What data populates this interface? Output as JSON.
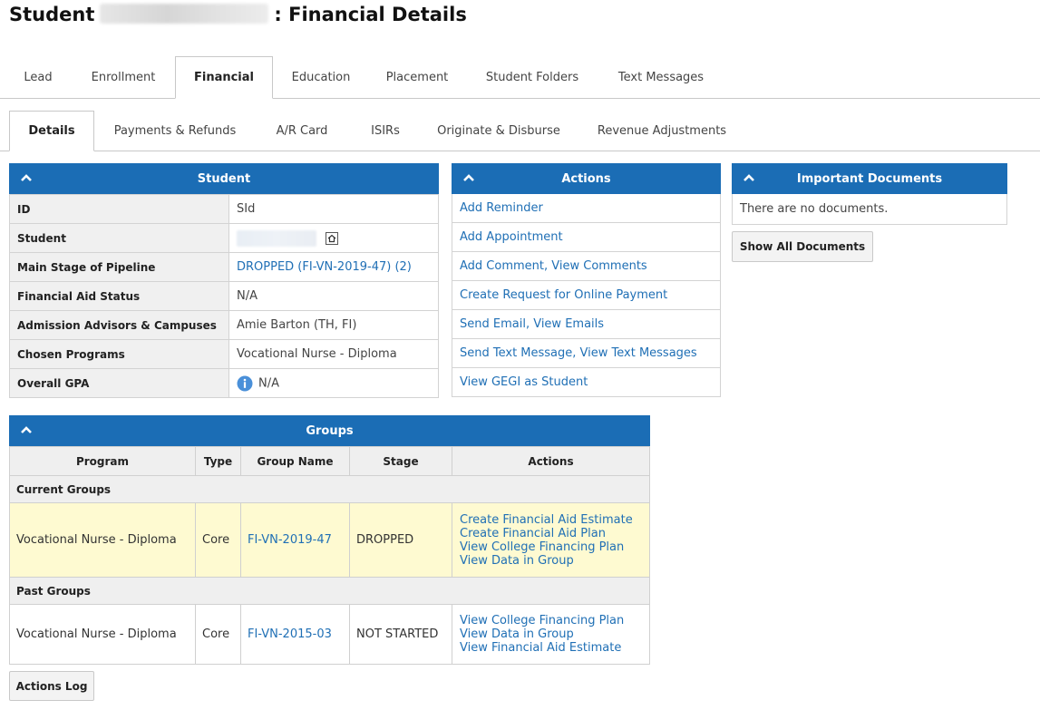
{
  "page": {
    "title_prefix": "Student",
    "title_suffix": ": Financial Details"
  },
  "main_tabs": [
    {
      "label": "Lead"
    },
    {
      "label": "Enrollment"
    },
    {
      "label": "Financial"
    },
    {
      "label": "Education"
    },
    {
      "label": "Placement"
    },
    {
      "label": "Student Folders"
    },
    {
      "label": "Text Messages"
    }
  ],
  "sub_tabs": [
    {
      "label": "Details"
    },
    {
      "label": "Payments & Refunds"
    },
    {
      "label": "A/R Card"
    },
    {
      "label": "ISIRs"
    },
    {
      "label": "Originate & Disburse"
    },
    {
      "label": "Revenue Adjustments"
    }
  ],
  "student_panel": {
    "title": "Student",
    "rows": [
      {
        "key": "ID",
        "value": "SId"
      },
      {
        "key": "Student",
        "value": ""
      },
      {
        "key": "Main Stage of Pipeline",
        "value": "DROPPED (FI-VN-2019-47) (2)"
      },
      {
        "key": "Financial Aid Status",
        "value": "N/A"
      },
      {
        "key": "Admission Advisors & Campuses",
        "value": "Amie Barton (TH, FI)"
      },
      {
        "key": "Chosen Programs",
        "value": "Vocational Nurse - Diploma"
      },
      {
        "key": "Overall GPA",
        "value": "N/A"
      }
    ]
  },
  "actions_panel": {
    "title": "Actions",
    "items": [
      "Add Reminder",
      "Add Appointment",
      "Add Comment, View Comments",
      "Create Request for Online Payment",
      "Send Email, View Emails",
      "Send Text Message, View Text Messages",
      "View GEGI as Student"
    ]
  },
  "documents_panel": {
    "title": "Important Documents",
    "empty_text": "There are no documents.",
    "show_all_label": "Show All Documents"
  },
  "groups_panel": {
    "title": "Groups",
    "columns": [
      "Program",
      "Type",
      "Group Name",
      "Stage",
      "Actions"
    ],
    "current_label": "Current Groups",
    "past_label": "Past Groups",
    "current": {
      "program": "Vocational Nurse - Diploma",
      "type": "Core",
      "group_name": "FI-VN-2019-47",
      "stage": "DROPPED",
      "actions": [
        "Create Financial Aid Estimate",
        "Create Financial Aid Plan",
        "View College Financing Plan",
        "View Data in Group"
      ]
    },
    "past": {
      "program": "Vocational Nurse - Diploma",
      "type": "Core",
      "group_name": "FI-VN-2015-03",
      "stage": "NOT STARTED",
      "actions": [
        "View College Financing Plan",
        "View Data in Group",
        "View Financial Aid Estimate"
      ]
    }
  },
  "actions_log_label": "Actions Log",
  "colors": {
    "header_blue": "#1b6db5",
    "link_blue": "#1f6fb5",
    "current_row": "#fefad1"
  },
  "icons": {
    "collapse": "chevron-up-icon",
    "home": "home-icon",
    "info": "info-icon"
  }
}
